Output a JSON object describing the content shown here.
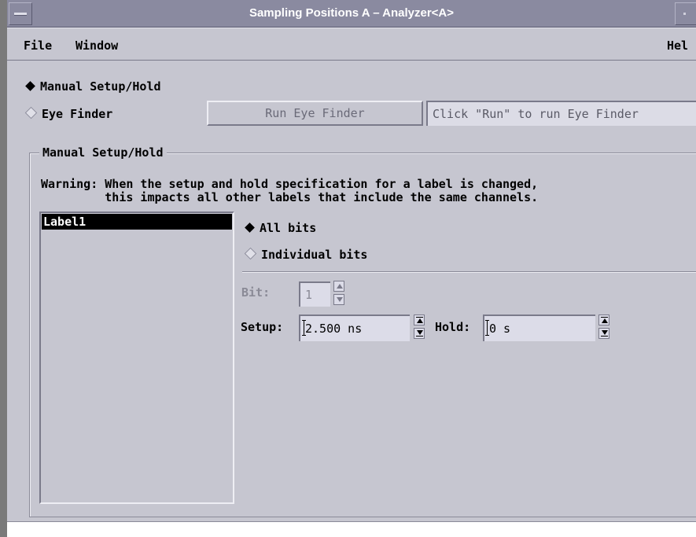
{
  "window": {
    "title": "Sampling Positions A – Analyzer<A>"
  },
  "menu": {
    "file": "File",
    "window": "Window",
    "help": "Hel"
  },
  "mode": {
    "manual_label": "Manual Setup/Hold",
    "eye_finder_label": "Eye Finder",
    "selected": "manual",
    "run_button": "Run Eye Finder",
    "status": "Click \"Run\" to run Eye Finder"
  },
  "group": {
    "title": "Manual Setup/Hold",
    "warning_line1": "Warning: When the setup and hold specification for a label is changed,",
    "warning_line2": "         this impacts all other labels that include the same channels."
  },
  "labels": {
    "items": [
      "Label1"
    ],
    "selected": "Label1"
  },
  "bits": {
    "all_label": "All bits",
    "individual_label": "Individual bits",
    "selected": "all"
  },
  "bit_field": {
    "label": "Bit:",
    "value": "1"
  },
  "setup_field": {
    "label": "Setup:",
    "value": "2.500 ns"
  },
  "hold_field": {
    "label": "Hold:",
    "value": "0 s"
  },
  "colors": {
    "chrome": "#c6c6d0",
    "titlebar": "#8a8aa0",
    "field": "#dcdce8",
    "selection": "#000000"
  }
}
